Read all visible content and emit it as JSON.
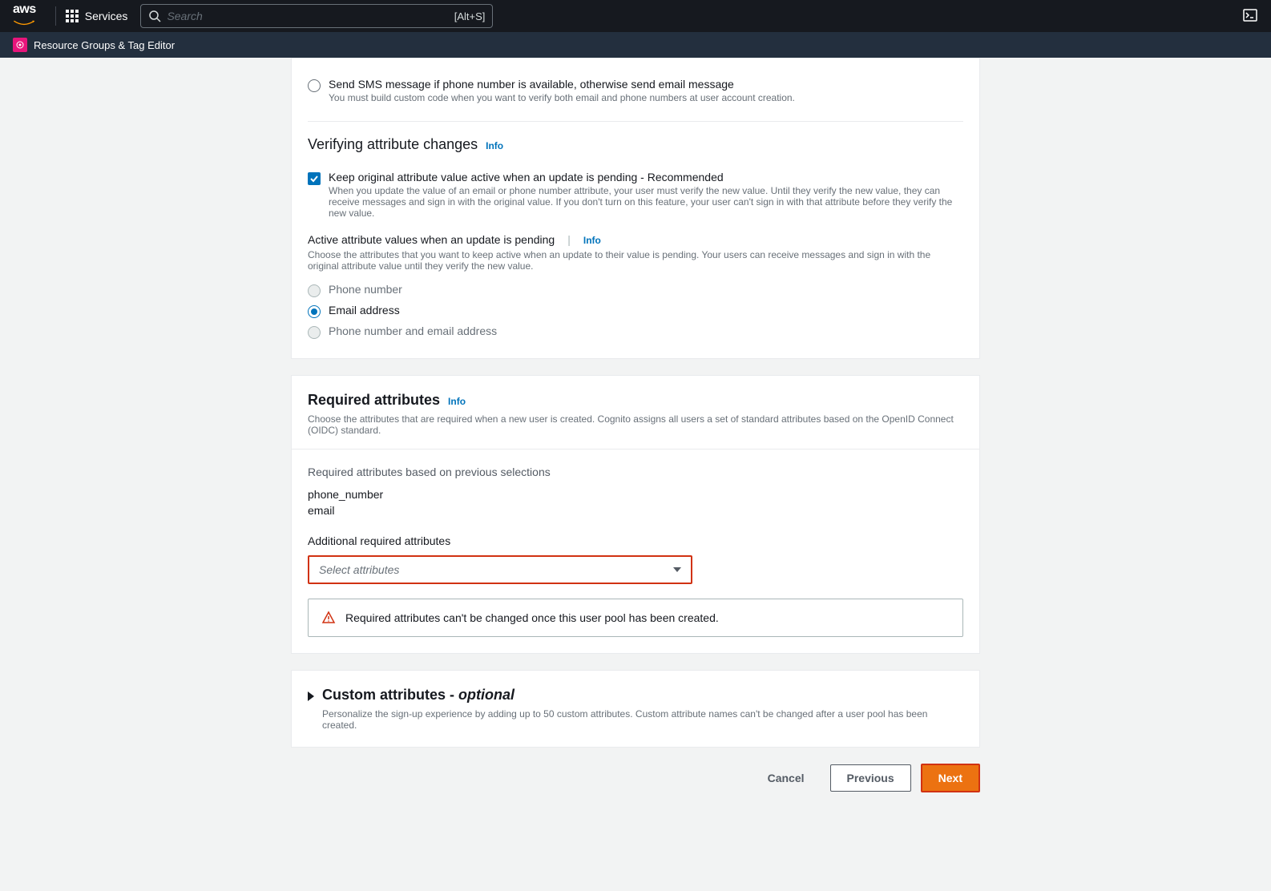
{
  "header": {
    "services_label": "Services",
    "search_placeholder": "Search",
    "search_shortcut": "[Alt+S]",
    "resource_groups_label": "Resource Groups & Tag Editor"
  },
  "sms_option": {
    "label": "Send SMS message if phone number is available, otherwise send email message",
    "desc": "You must build custom code when you want to verify both email and phone numbers at user account creation."
  },
  "verifying_section": {
    "title": "Verifying attribute changes",
    "info": "Info",
    "checkbox_label": "Keep original attribute value active when an update is pending - Recommended",
    "checkbox_desc": "When you update the value of an email or phone number attribute, your user must verify the new value. Until they verify the new value, they can receive messages and sign in with the original value. If you don't turn on this feature, your user can't sign in with that attribute before they verify the new value.",
    "active_label": "Active attribute values when an update is pending",
    "active_info": "Info",
    "active_desc": "Choose the attributes that you want to keep active when an update to their value is pending. Your users can receive messages and sign in with the original attribute value until they verify the new value.",
    "radio_phone": "Phone number",
    "radio_email": "Email address",
    "radio_both": "Phone number and email address"
  },
  "required_section": {
    "title": "Required attributes",
    "info": "Info",
    "desc": "Choose the attributes that are required when a new user is created. Cognito assigns all users a set of standard attributes based on the OpenID Connect (OIDC) standard.",
    "prev_label": "Required attributes based on previous selections",
    "attr_phone": "phone_number",
    "attr_email": "email",
    "additional_label": "Additional required attributes",
    "select_placeholder": "Select attributes",
    "warning_text": "Required attributes can't be changed once this user pool has been created."
  },
  "custom_section": {
    "title": "Custom attributes - ",
    "optional": "optional",
    "desc": "Personalize the sign-up experience by adding up to 50 custom attributes. Custom attribute names can't be changed after a user pool has been created."
  },
  "buttons": {
    "cancel": "Cancel",
    "previous": "Previous",
    "next": "Next"
  }
}
